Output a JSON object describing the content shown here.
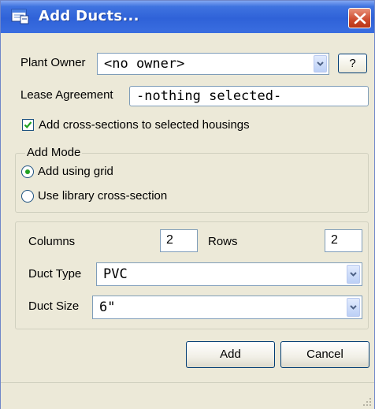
{
  "window": {
    "title": "Add Ducts..."
  },
  "plant_owner": {
    "label": "Plant Owner",
    "value": "<no owner>",
    "help_label": "?"
  },
  "lease_agreement": {
    "label": "Lease Agreement",
    "value": "-nothing selected-"
  },
  "cross_sections": {
    "label": "Add cross-sections to selected housings",
    "checked": true
  },
  "add_mode": {
    "legend": "Add Mode",
    "options": [
      {
        "label": "Add using grid",
        "selected": true
      },
      {
        "label": "Use library cross-section",
        "selected": false
      }
    ]
  },
  "grid": {
    "columns_label": "Columns",
    "columns_value": "2",
    "rows_label": "Rows",
    "rows_value": "2",
    "duct_type_label": "Duct Type",
    "duct_type_value": "PVC",
    "duct_size_label": "Duct Size",
    "duct_size_value": "6\""
  },
  "buttons": {
    "add": "Add",
    "cancel": "Cancel"
  },
  "colors": {
    "title_bar": "#2f62d8",
    "dialog_bg": "#ece9d8",
    "close_button": "#cd4a2d",
    "check_mark": "#21a121"
  }
}
